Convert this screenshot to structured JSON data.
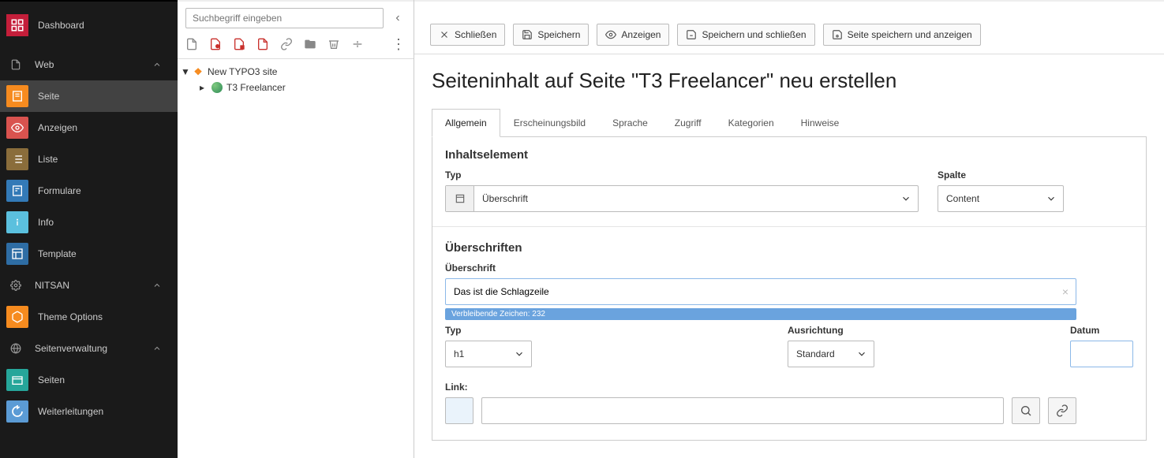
{
  "sidebar": {
    "dashboard": "Dashboard",
    "web": "Web",
    "page": "Seite",
    "view": "Anzeigen",
    "list": "Liste",
    "forms": "Formulare",
    "info": "Info",
    "template": "Template",
    "nitsan": "NITSAN",
    "theme_options": "Theme Options",
    "site_mgmt": "Seitenverwaltung",
    "sites": "Seiten",
    "redirects": "Weiterleitungen"
  },
  "tree": {
    "search_placeholder": "Suchbegriff eingeben",
    "root": "New TYPO3 site",
    "child": "T3 Freelancer"
  },
  "actions": {
    "close": "Schließen",
    "save": "Speichern",
    "view": "Anzeigen",
    "save_close": "Speichern und schließen",
    "save_view": "Seite speichern und anzeigen"
  },
  "page": {
    "title": "Seiteninhalt auf Seite \"T3 Freelancer\" neu erstellen"
  },
  "tabs": {
    "general": "Allgemein",
    "appearance": "Erscheinungsbild",
    "language": "Sprache",
    "access": "Zugriff",
    "categories": "Kategorien",
    "notes": "Hinweise"
  },
  "form": {
    "content_element": "Inhaltselement",
    "type_label": "Typ",
    "type_value": "Überschrift",
    "column_label": "Spalte",
    "column_value": "Content",
    "headers_section": "Überschriften",
    "header_label": "Überschrift",
    "header_value": "Das ist die Schlagzeile",
    "chars_remaining": "Verbleibende Zeichen: 232",
    "htype_label": "Typ",
    "htype_value": "h1",
    "align_label": "Ausrichtung",
    "align_value": "Standard",
    "date_label": "Datum",
    "link_label": "Link:"
  }
}
